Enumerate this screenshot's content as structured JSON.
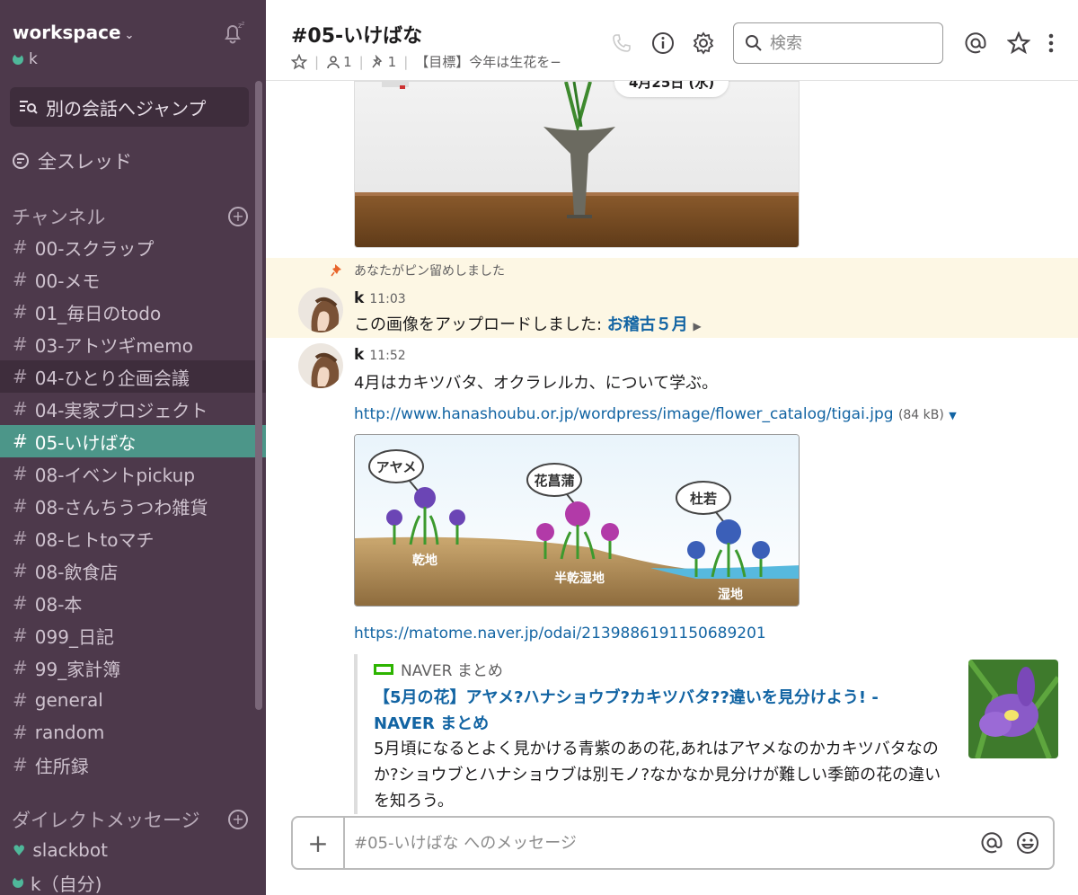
{
  "workspace": {
    "name": "workspace",
    "caret": "⌄",
    "user": "k"
  },
  "sidebar": {
    "jump_label": "別の会話へジャンプ",
    "all_threads": "全スレッド",
    "channels_header": "チャンネル",
    "channels": [
      {
        "hash": "#",
        "label": "00-スクラップ"
      },
      {
        "hash": "#",
        "label": "00-メモ"
      },
      {
        "hash": "#",
        "label": "01_毎日のtodo"
      },
      {
        "hash": "#",
        "label": "03-アトツギmemo"
      },
      {
        "hash": "#",
        "label": "04-ひとり企画会議"
      },
      {
        "hash": "#",
        "label": "04-実家プロジェクト"
      },
      {
        "hash": "#",
        "label": "05-いけばな"
      },
      {
        "hash": "#",
        "label": "08-イベントpickup"
      },
      {
        "hash": "#",
        "label": "08-さんちうつわ雑貨"
      },
      {
        "hash": "#",
        "label": "08-ヒトtoマチ"
      },
      {
        "hash": "#",
        "label": "08-飲食店"
      },
      {
        "hash": "#",
        "label": "08-本"
      },
      {
        "hash": "#",
        "label": "099_日記"
      },
      {
        "hash": "#",
        "label": "99_家計簿"
      },
      {
        "hash": "#",
        "label": "general"
      },
      {
        "hash": "#",
        "label": "random"
      },
      {
        "hash": "#",
        "label": "住所録"
      }
    ],
    "dm_header": "ダイレクトメッセージ",
    "dms": [
      {
        "label": "slackbot"
      },
      {
        "label": "k（自分)"
      }
    ]
  },
  "header": {
    "channel_title": "#05-いけばな",
    "members": "1",
    "pins": "1",
    "topic": "【目標】今年は生花を−",
    "sep": "|"
  },
  "search": {
    "placeholder": "検索"
  },
  "messages": {
    "date_divider": "4月25日 (水)",
    "pinned_note": "あなたがピン留めしました",
    "msg1": {
      "author": "k",
      "time": "11:03",
      "text": "この画像をアップロードしました: ",
      "file_link": "お稽古５月"
    },
    "msg2": {
      "author": "k",
      "time": "11:52",
      "text": "4月はカキツバタ、オクラレルカ、について学ぶ。",
      "link1": "http://www.hanashoubu.or.jp/wordpress/image/flower_catalog/tigai.jpg",
      "link1_size": "(84 kB)",
      "link2": "https://matome.naver.jp/odai/2139886191150689201"
    },
    "iris_image": {
      "labels": [
        "アヤメ",
        "花菖蒲",
        "杜若"
      ],
      "ground": [
        "乾地",
        "半乾湿地",
        "湿地"
      ]
    },
    "unfurl": {
      "source": "NAVER まとめ",
      "title": "【5月の花】アヤメ?ハナショウブ?カキツバタ??違いを見分けよう! - NAVER まとめ",
      "description": "5月頃になるとよく見かける青紫のあの花,あれはアヤメなのかカキツバタなのか?ショウブとハナショウブは別モノ?なかなか見分けが難しい季節の花の違いを知ろう。"
    }
  },
  "composer": {
    "placeholder": "#05-いけばな へのメッセージ",
    "plus": "+"
  },
  "colors": {
    "sidebar_bg": "#4d394b",
    "active_channel": "#4c9689",
    "link": "#1264a3",
    "pinned_bg": "#fdf7e4"
  }
}
